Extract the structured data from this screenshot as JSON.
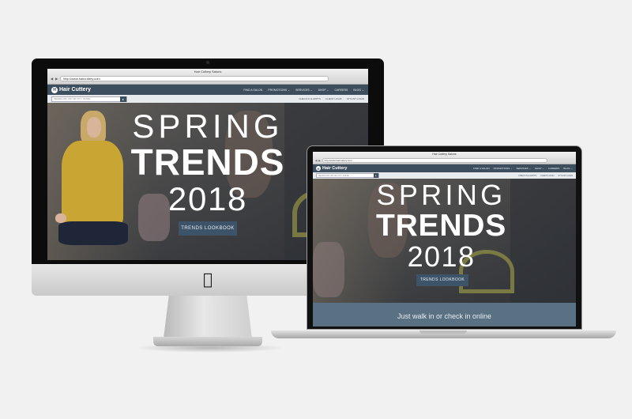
{
  "browser": {
    "window_title": "Hair Cuttery Salons",
    "address": "http://www.haircuttery.com"
  },
  "site": {
    "logo_text": "Hair Cuttery",
    "logo_mark": "H",
    "nav": [
      "FIND A SALON",
      "PROMOTIONS ⌄",
      "SERVICES ⌄",
      "SHOP ⌄",
      "CAREERS",
      "BLOG ⌄"
    ],
    "search_placeholder": "SEARCH BY ZIP OR CITY, STATE",
    "search_button": "▸",
    "util_links": [
      "CHECK IN & APPTS",
      "CLIENT LOGIN",
      "STYLIST LOGIN"
    ]
  },
  "hero": {
    "line1": "SPRING",
    "line2": "TRENDS",
    "line3": "2018",
    "cta": "TRENDS LOOKBOOK"
  },
  "banner_strip": "Just walk in or check in online",
  "icons": {
    "apple": "",
    "back": "◀",
    "forward": "▶"
  },
  "colors": {
    "navbar": "#3d4f5f",
    "cta": "#3d5468"
  }
}
